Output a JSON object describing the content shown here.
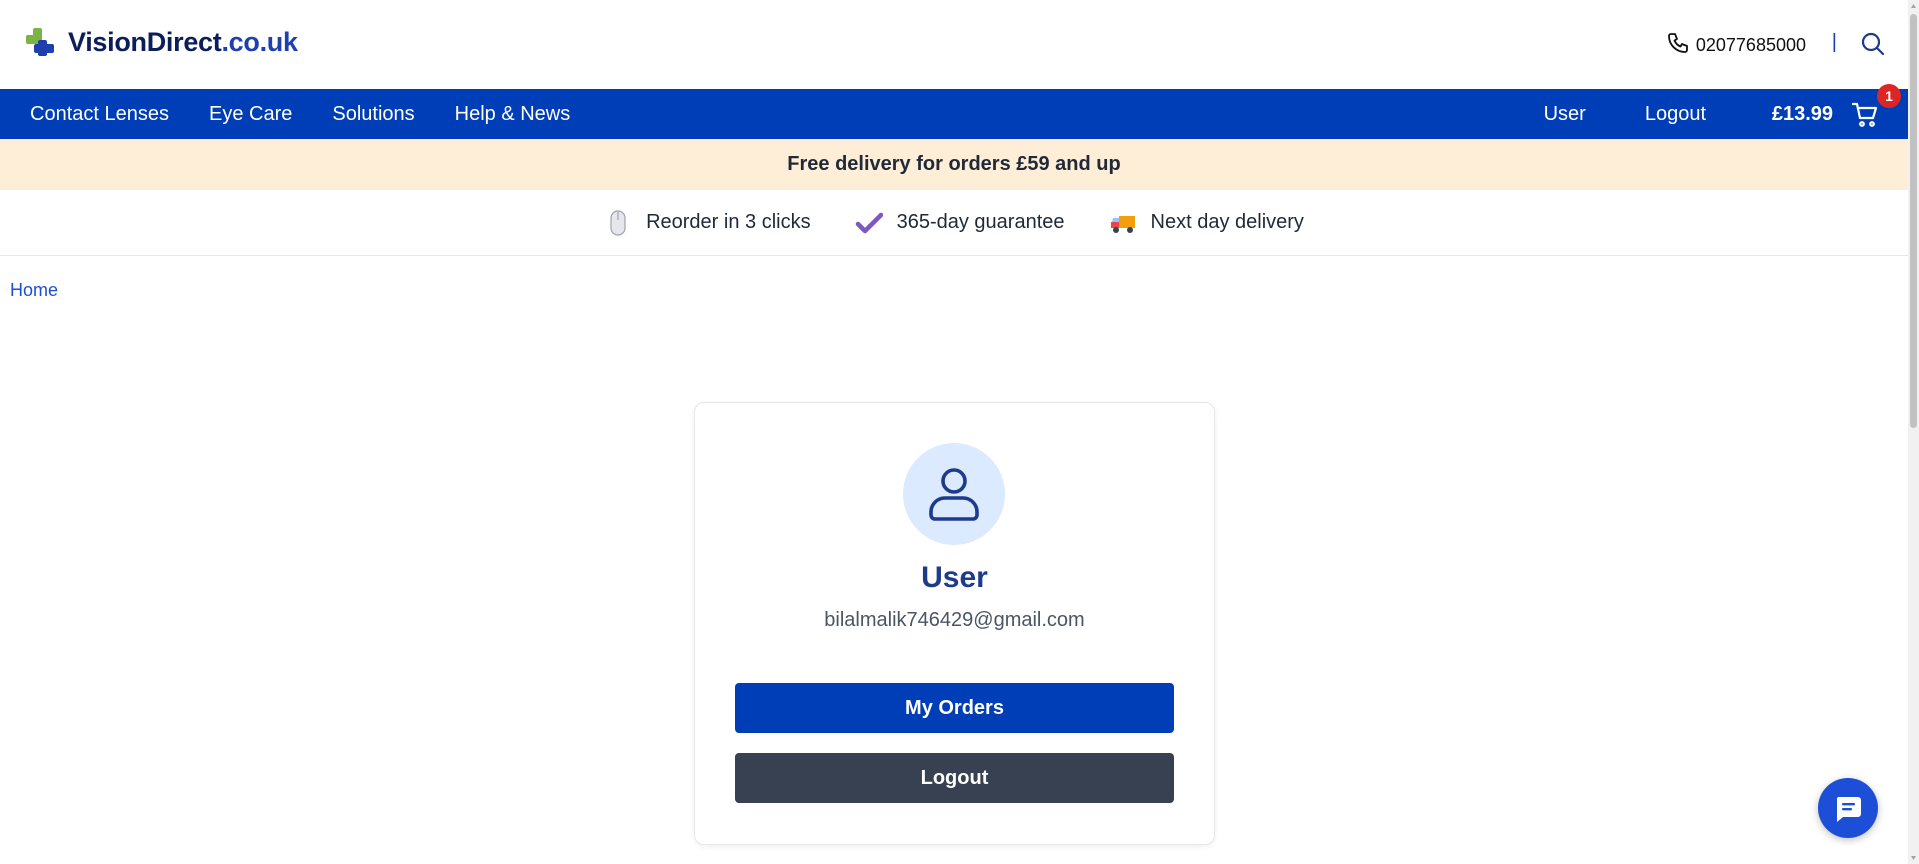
{
  "header": {
    "logo": {
      "part1": "Vision",
      "part2": "Direct",
      "part3": ".co.uk"
    },
    "phone": "02077685000",
    "separator": "|"
  },
  "nav": {
    "items": [
      "Contact Lenses",
      "Eye Care",
      "Solutions",
      "Help & News"
    ],
    "user": "User",
    "logout": "Logout",
    "cart_total": "£13.99",
    "cart_count": "1"
  },
  "promo": {
    "text": "Free delivery for orders £59 and up"
  },
  "usps": [
    {
      "icon": "mouse-icon",
      "label": "Reorder in 3 clicks"
    },
    {
      "icon": "checkmark-icon",
      "label": "365-day guarantee"
    },
    {
      "icon": "delivery-truck-icon",
      "label": "Next day delivery"
    }
  ],
  "breadcrumb": {
    "home": "Home"
  },
  "account": {
    "name": "User",
    "email": "bilalmalik746429@gmail.com",
    "orders_button": "My Orders",
    "logout_button": "Logout"
  },
  "colors": {
    "brand_blue": "#003eb7",
    "promo_bg": "#feedd7",
    "logout_btn": "#374151",
    "badge_red": "#dc2626"
  }
}
